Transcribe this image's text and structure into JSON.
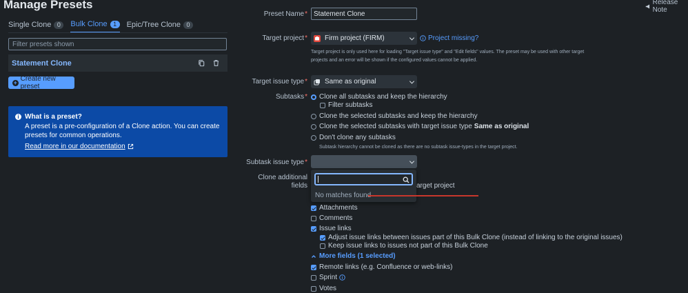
{
  "page": {
    "title": "Manage Presets",
    "release_notes": "Release Note"
  },
  "tabs": [
    {
      "label": "Single Clone",
      "count": "0"
    },
    {
      "label": "Bulk Clone",
      "count": "1"
    },
    {
      "label": "Epic/Tree Clone",
      "count": "0"
    }
  ],
  "filter": {
    "placeholder": "Filter presets shown",
    "value": ""
  },
  "presets": [
    {
      "name": "Statement Clone"
    }
  ],
  "create_button": "Create new preset",
  "info": {
    "title": "What is a preset?",
    "text": "A preset is a pre-configuration of a Clone action. You can create presets for common operations.",
    "link": "Read more in our documentation"
  },
  "form": {
    "preset_name": {
      "label": "Preset Name",
      "value": "Statement Clone"
    },
    "target_project": {
      "label": "Target project",
      "value": "Firm project (FIRM)",
      "missing_link": "Project missing?",
      "hint": "Target project is only used here for loading \"Target issue type\" and \"Edit fields\" values. The preset may be used with other target projects and an error will be shown if the configured values cannot be applied."
    },
    "target_issue_type": {
      "label": "Target issue type",
      "value": "Same as original"
    },
    "subtasks": {
      "label": "Subtasks",
      "options": {
        "clone_all": "Clone all subtasks and keep the hierarchy",
        "filter": "Filter subtasks",
        "clone_selected": "Clone the selected subtasks and keep the hierarchy",
        "clone_selected_type_prefix": "Clone the selected subtasks with target issue type",
        "clone_selected_type_bold": "Same as original",
        "dont_clone": "Don't clone any subtasks"
      },
      "hint": "Subtask hierarchy cannot be cloned as there are no subtask issue-types in the target project."
    },
    "subtask_issue_type": {
      "label": "Subtask issue type",
      "search_value": "",
      "no_matches": "No matches found"
    },
    "additional_fields": {
      "label_line1": "Clone additional",
      "label_line2": "fields",
      "partial_text": "arget project",
      "items": {
        "attachments": "Attachments",
        "comments": "Comments",
        "issue_links": "Issue links",
        "adjust_links": "Adjust issue links between issues part of this Bulk Clone (instead of linking to the original issues)",
        "keep_links": "Keep issue links to issues not part of this Bulk Clone",
        "more_fields": "More fields (1 selected)",
        "remote_links": "Remote links (e.g. Confluence or web-links)",
        "sprint": "Sprint",
        "votes": "Votes"
      }
    }
  },
  "colors": {
    "background": "#1d2125",
    "accent": "#579dff",
    "info_box": "#0c4aa6",
    "required": "#f87168",
    "annotation_line": "#c9372c"
  }
}
